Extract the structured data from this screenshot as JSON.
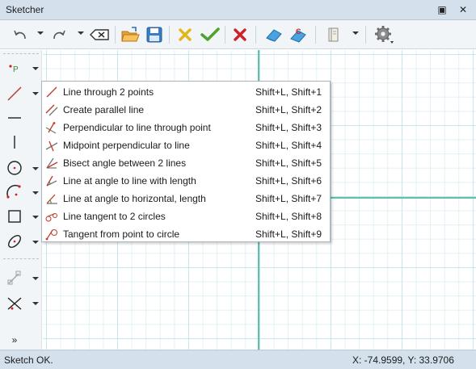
{
  "window": {
    "title": "Sketcher",
    "restore_glyph": "▣",
    "close_glyph": "✕"
  },
  "toolbar": {
    "icons": [
      "undo-icon",
      "redo-icon",
      "delete-back-icon",
      "open-folder-icon",
      "save-icon",
      "cancel-x-icon",
      "accept-check-icon",
      "close-red-x-icon",
      "eraser-icon",
      "eraser-c-icon",
      "book-icon",
      "gear-icon"
    ]
  },
  "left_toolbar": {
    "tools": [
      "point-tool",
      "line-tool",
      "horizontal-line-tool",
      "vertical-line-tool",
      "circle-tool",
      "arc-tool",
      "rectangle-tool",
      "ellipse-tool",
      "constraint-tool",
      "trim-tool"
    ],
    "more_glyph": "»"
  },
  "menu": {
    "items": [
      {
        "label": "Line through 2 points",
        "shortcut": "Shift+L, Shift+1"
      },
      {
        "label": "Create parallel line",
        "shortcut": "Shift+L, Shift+2"
      },
      {
        "label": "Perpendicular to line through point",
        "shortcut": "Shift+L, Shift+3"
      },
      {
        "label": "Midpoint perpendicular to line",
        "shortcut": "Shift+L, Shift+4"
      },
      {
        "label": "Bisect angle between 2 lines",
        "shortcut": "Shift+L, Shift+5"
      },
      {
        "label": "Line at angle to line with length",
        "shortcut": "Shift+L, Shift+6"
      },
      {
        "label": "Line at angle to horizontal, length",
        "shortcut": "Shift+L, Shift+7"
      },
      {
        "label": "Line tangent to 2 circles",
        "shortcut": "Shift+L, Shift+8"
      },
      {
        "label": "Tangent from point to circle",
        "shortcut": "Shift+L, Shift+9"
      }
    ]
  },
  "status": {
    "message": "Sketch OK.",
    "coords": "X: -74.9599, Y: 33.9706"
  },
  "colors": {
    "axis": "#5fc0ae",
    "grid": "#aad7e6",
    "line_icon": "#c0392b",
    "chrome": "#d4e0ec"
  }
}
